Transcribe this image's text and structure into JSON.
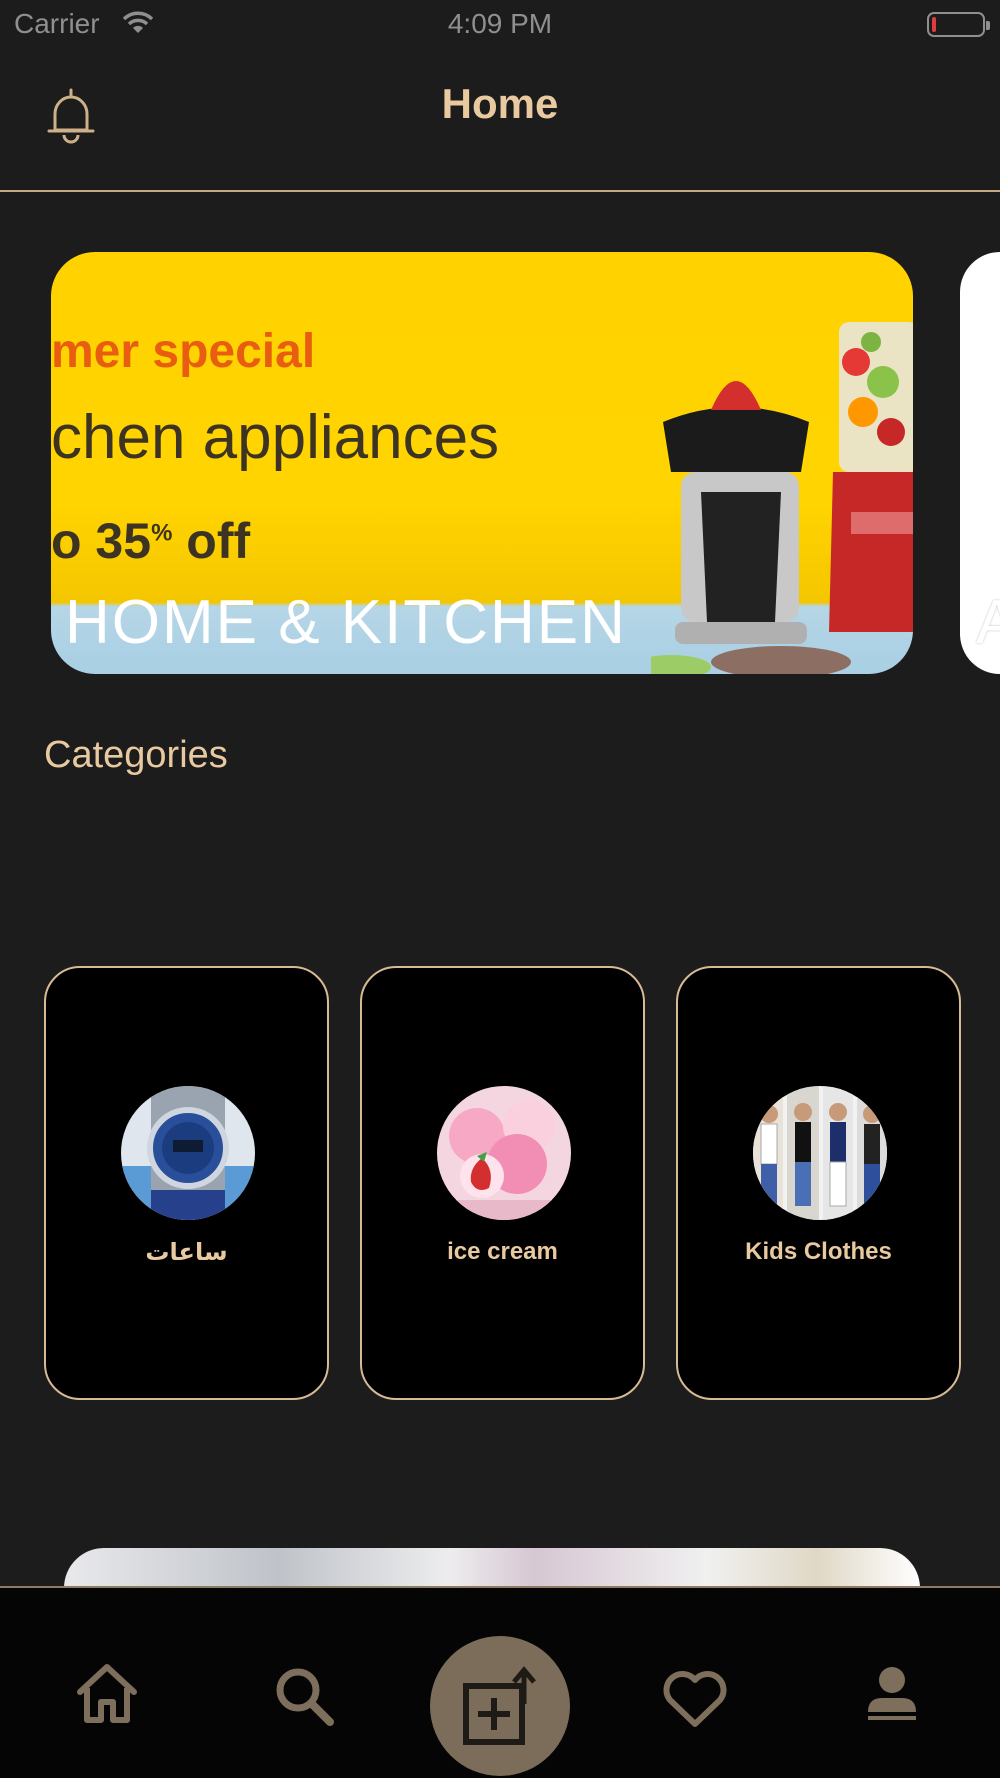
{
  "status_bar": {
    "carrier": "Carrier",
    "time": "4:09 PM"
  },
  "header": {
    "title": "Home"
  },
  "banner": {
    "line1": "mer special",
    "line2": "chen appliances",
    "line3_prefix": "o 35",
    "line3_sup": "%",
    "line3_suffix": " off",
    "caption": "HOME  & KITCHEN",
    "next_caption": "A"
  },
  "categories": {
    "title": "Categories",
    "items": [
      {
        "label": "ساعات"
      },
      {
        "label": "ice cream"
      },
      {
        "label": "Kids Clothes"
      }
    ]
  },
  "colors": {
    "accent": "#e8c9a0",
    "background": "#1c1c1c",
    "card": "#000000",
    "tab_center": "#7c6c5a"
  },
  "tabs": [
    {
      "icon": "home-icon"
    },
    {
      "icon": "search-icon"
    },
    {
      "icon": "add-post-icon"
    },
    {
      "icon": "heart-icon"
    },
    {
      "icon": "profile-icon"
    }
  ]
}
